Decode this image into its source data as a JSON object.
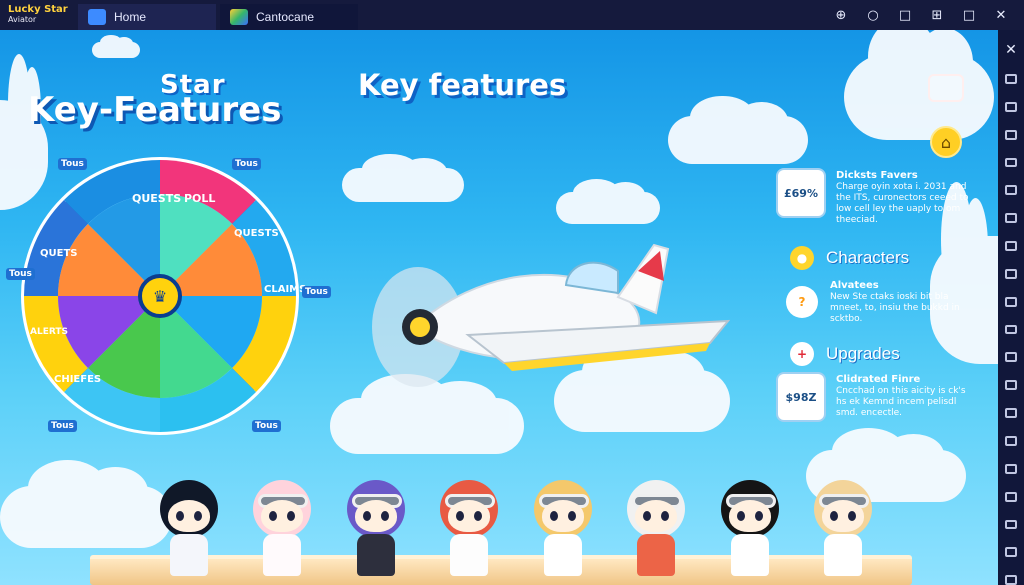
{
  "app": {
    "logo_line1": "Lucky Star",
    "logo_line2": "Aviator"
  },
  "tabs": [
    {
      "label": "Home"
    },
    {
      "label": "Cantocane"
    }
  ],
  "window_controls": [
    "⊕",
    "○",
    "□",
    "⊞",
    "□",
    "✕"
  ],
  "hero": {
    "title_star": "Star",
    "title_left": "Key-Features",
    "title_right": "Key features"
  },
  "wheel": {
    "labels": [
      "QUESTS",
      "POLL",
      "QUESTS",
      "CLAIMS",
      "QUETS",
      "ALERTS",
      "CHIEFES"
    ],
    "small_tags": [
      "Tous",
      "Tous",
      "Tous",
      "Tous",
      "Tous",
      "Tous"
    ]
  },
  "features": [
    {
      "title": "Dicksts Favers",
      "desc": "Charge oyin xota i. 2031 and the ITS, curonectors ceeed to low cell ley the uaply to om theeciad.",
      "icon_text": "£69%"
    },
    {
      "label": "Characters"
    },
    {
      "title": "Alvatees",
      "desc": "New Ste ctaks ioski bit bla mneet, to, insiu the bukkd in scktbo."
    },
    {
      "label": "Upgrades"
    },
    {
      "title": "Clidrated Finre",
      "desc": "Cncchad on this aicity is ck's hs ek Kemnd incem pelisdl smd. encectle.",
      "icon_text": "$98Z"
    }
  ],
  "colors": {
    "sky_top": "#1495e6",
    "accent_yellow": "#ffd23e",
    "titlebar": "#151a3d"
  },
  "icons": {
    "home": "home-icon",
    "book": "open-book-icon",
    "plus": "plus-icon"
  }
}
